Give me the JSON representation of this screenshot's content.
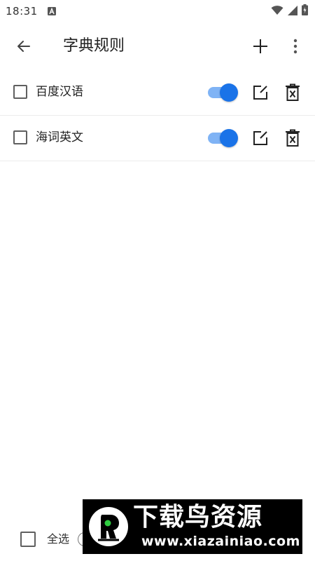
{
  "status_bar": {
    "time": "18:31",
    "icons": [
      "a-notification-icon",
      "wifi-icon",
      "signal-icon",
      "battery-icon"
    ]
  },
  "toolbar": {
    "title": "字典规则",
    "back_icon": "arrow-left-icon",
    "add_icon": "plus-icon",
    "more_icon": "more-vertical-icon"
  },
  "rules": [
    {
      "name": "百度汉语",
      "checked": false,
      "enabled": true
    },
    {
      "name": "海词英文",
      "checked": false,
      "enabled": true
    }
  ],
  "bottom_bar": {
    "select_all_label": "全选",
    "select_all_checked": false
  },
  "watermark": {
    "title": "下载鸟资源",
    "url": "www.xiazainiao.com"
  },
  "colors": {
    "accent": "#1a73e8",
    "accent_track": "#7fb3f5",
    "text": "#222222",
    "divider": "#ececec"
  }
}
